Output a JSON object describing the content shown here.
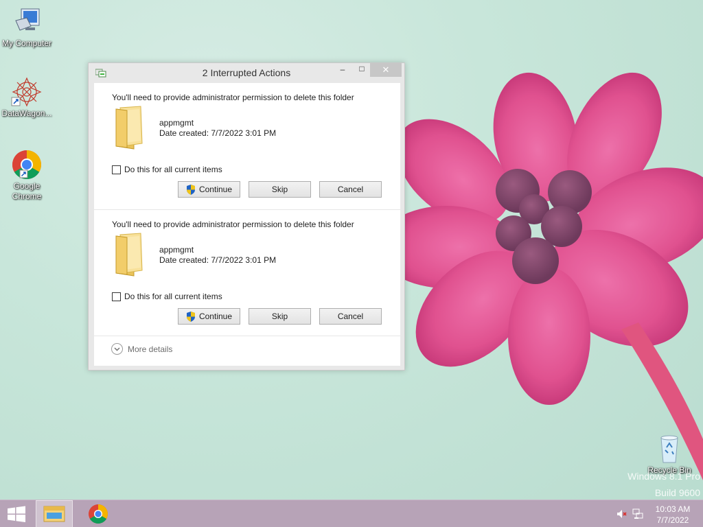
{
  "desktop": {
    "icons": [
      {
        "label": "My Computer",
        "icon": "computer-icon"
      },
      {
        "label": "DataWagon...",
        "icon": "datawagon-icon"
      },
      {
        "label": "Google Chrome",
        "icon": "chrome-icon"
      },
      {
        "label": "Recycle Bin",
        "icon": "recycle-bin-icon"
      }
    ],
    "watermark": {
      "line1": "Windows 8.1 Pro",
      "line2": "Build 9600"
    }
  },
  "dialog": {
    "title": "2 Interrupted Actions",
    "controls": {
      "minimize": "–",
      "maximize": "□",
      "close": "✕"
    },
    "items": [
      {
        "message": "You'll need to provide administrator permission to delete this folder",
        "name": "appmgmt",
        "date": "Date created: 7/7/2022 3:01 PM",
        "checkbox_label": "Do this for all current items",
        "checked": false,
        "continue_label": "Continue",
        "skip_label": "Skip",
        "cancel_label": "Cancel"
      },
      {
        "message": "You'll need to provide administrator permission to delete this folder",
        "name": "appmgmt",
        "date": "Date created: 7/7/2022 3:01 PM",
        "checkbox_label": "Do this for all current items",
        "checked": false,
        "continue_label": "Continue",
        "skip_label": "Skip",
        "cancel_label": "Cancel"
      }
    ],
    "more_details": "More details"
  },
  "taskbar": {
    "pinned": [
      "windows-start-icon",
      "file-explorer-icon",
      "chrome-icon"
    ],
    "tray": [
      "volume-muted-icon",
      "network-icon"
    ],
    "time": "10:03 AM",
    "date": "7/7/2022"
  },
  "colors": {
    "accent": "#0078d7",
    "taskbar": "#b7a3b7",
    "flower": "#e3508f"
  }
}
